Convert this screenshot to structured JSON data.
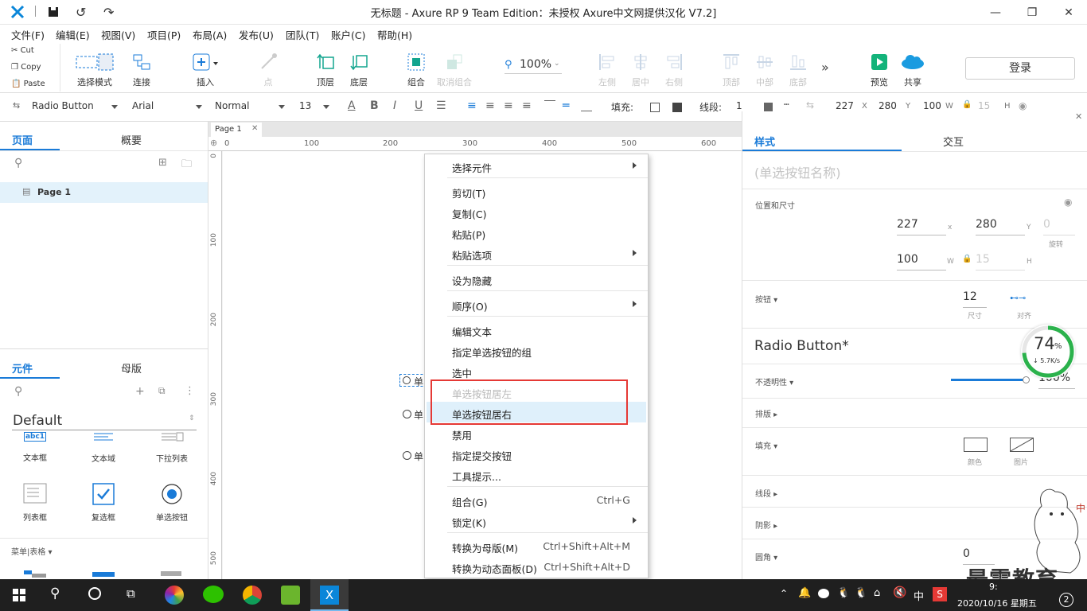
{
  "window": {
    "title": "无标题 - Axure RP 9 Team Edition：未授权    Axure中文网提供汉化 V7.2]",
    "buttons": {
      "minimize": "—",
      "maximize": "❐",
      "close": "✕"
    }
  },
  "menubar": [
    "文件(F)",
    "编辑(E)",
    "视图(V)",
    "项目(P)",
    "布局(A)",
    "发布(U)",
    "团队(T)",
    "账户(C)",
    "帮助(H)"
  ],
  "clipboard": {
    "cut": "Cut",
    "copy": "Copy",
    "paste": "Paste"
  },
  "toolbar": {
    "select_mode": "选择模式",
    "connect": "连接",
    "insert": "插入",
    "point": "点",
    "top": "顶层",
    "bottom": "底层",
    "group": "组合",
    "ungroup": "取消组合",
    "zoom": "100%",
    "left": "左侧",
    "center": "居中",
    "right": "右侧",
    "top_align": "顶部",
    "middle": "中部",
    "bottom_align": "底部",
    "preview": "预览",
    "share": "共享",
    "login": "登录"
  },
  "formatbar": {
    "widget": "Radio Button",
    "font": "Arial",
    "style": "Normal",
    "size": "13",
    "fill_label": "填充:",
    "stroke_label": "线段:",
    "stroke_value": "1",
    "x": "227",
    "x_label": "X",
    "y": "280",
    "y_label": "Y",
    "w": "100",
    "w_label": "W",
    "h": "15",
    "h_label": "H"
  },
  "leftpanel": {
    "tab_pages": "页面",
    "tab_outline": "概要",
    "page_item": "Page 1",
    "tab_widgets": "元件",
    "tab_masters": "母版",
    "library": "Default",
    "widgets": [
      {
        "label": "文本框",
        "icon": "abc1"
      },
      {
        "label": "文本域",
        "icon": ""
      },
      {
        "label": "下拉列表",
        "icon": ""
      },
      {
        "label": "列表框",
        "icon": ""
      },
      {
        "label": "复选框",
        "icon": ""
      },
      {
        "label": "单选按钮",
        "icon": ""
      }
    ],
    "section": "菜单|表格 ▾"
  },
  "canvas": {
    "tab": "Page 1",
    "ruler_h": [
      "0",
      "100",
      "200",
      "300",
      "400",
      "500",
      "600"
    ],
    "ruler_v": [
      "0",
      "100",
      "200",
      "300",
      "400",
      "500"
    ],
    "radio_label": "单"
  },
  "contextmenu": {
    "items": [
      {
        "label": "选择元件",
        "submenu": true
      },
      {
        "label": "剪切(T)"
      },
      {
        "label": "复制(C)"
      },
      {
        "label": "粘贴(P)"
      },
      {
        "label": "粘贴选项",
        "submenu": true
      },
      {
        "label": "设为隐藏"
      },
      {
        "label": "顺序(O)",
        "submenu": true
      },
      {
        "label": "编辑文本"
      },
      {
        "label": "指定单选按钮的组"
      },
      {
        "label": "选中"
      },
      {
        "label": "单选按钮居左",
        "disabled": true
      },
      {
        "label": "单选按钮居右",
        "highlighted": true
      },
      {
        "label": "禁用"
      },
      {
        "label": "指定提交按钮"
      },
      {
        "label": "工具提示..."
      },
      {
        "label": "组合(G)",
        "shortcut": "Ctrl+G"
      },
      {
        "label": "锁定(K)",
        "submenu": true
      },
      {
        "label": "转换为母版(M)",
        "shortcut": "Ctrl+Shift+Alt+M"
      },
      {
        "label": "转换为动态面板(D)",
        "shortcut": "Ctrl+Shift+Alt+D"
      }
    ]
  },
  "rightpanel": {
    "tab_style": "样式",
    "tab_interact": "交互",
    "name_placeholder": "(单选按钮名称)",
    "pos_size": "位置和尺寸",
    "x": "227",
    "x_unit": "x",
    "y": "280",
    "y_unit": "Y",
    "rotate": "0",
    "rotate_unit": "旋转",
    "w": "100",
    "w_unit": "W",
    "h": "15",
    "h_unit": "H",
    "button_label": "按钮 ▾",
    "btn_size": "12",
    "btn_size_label": "尺寸",
    "align_label": "对齐",
    "style_name": "Radio Button*",
    "opacity_label": "不透明性 ▾",
    "opacity_value": "100%",
    "typography": "排版 ▸",
    "fill": "填充 ▾",
    "fill_color": "颜色",
    "fill_image": "图片",
    "stroke": "线段 ▸",
    "shadow": "阴影 ▸",
    "corner": "圆角 ▾",
    "corner_value": "0"
  },
  "netwidget": {
    "percent": "74",
    "unit": "%",
    "speed": "↓ 5.7K/s",
    "progress": 0.74
  },
  "watermark": "最需教育",
  "taskbar": {
    "lang": "中",
    "time": "9:",
    "date": "2020/10/16 星期五",
    "notif": "2"
  },
  "colors": {
    "accent": "#1a7bd8",
    "highlight_box": "#e53935",
    "hover": "#dff0fb",
    "preview": "#13b37a"
  }
}
